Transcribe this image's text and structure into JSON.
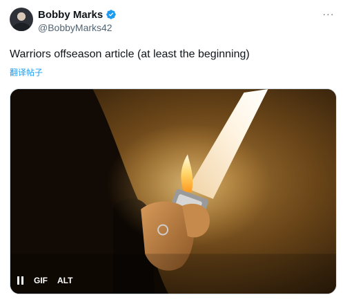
{
  "author": {
    "display_name": "Bobby Marks",
    "handle": "@BobbyMarks42",
    "verified": true,
    "avatar_icon": "user-avatar"
  },
  "header": {
    "more_label": "···"
  },
  "tweet": {
    "text": "Warriors offseason article (at least the beginning)",
    "translate_label": "翻译帖子"
  },
  "media": {
    "type": "gif",
    "controls": {
      "pause_icon": "pause-icon",
      "gif_label": "GIF",
      "alt_label": "ALT"
    }
  },
  "colors": {
    "accent": "#1d9bf0",
    "text_primary": "#0f1419",
    "text_secondary": "#536471"
  }
}
